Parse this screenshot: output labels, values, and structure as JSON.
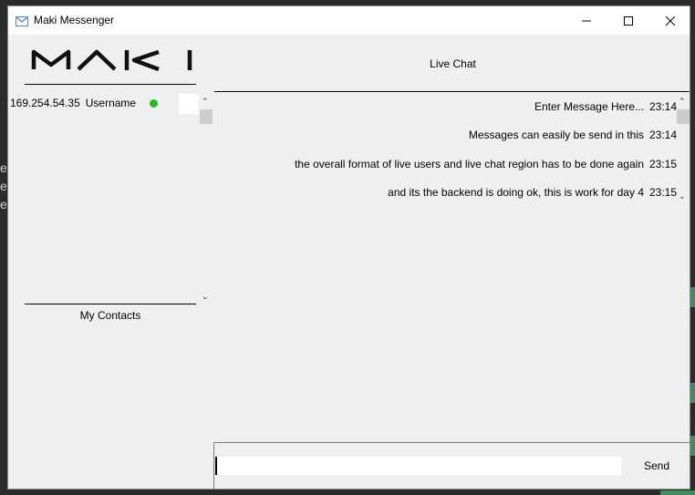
{
  "window": {
    "title": "Maki Messenger",
    "controls": [
      "minimize",
      "maximize",
      "close"
    ]
  },
  "logo": {
    "text": "MAKI"
  },
  "contacts": {
    "items": [
      {
        "ip": "169.254.54.35",
        "username": "Username",
        "status": "online",
        "status_color": "#18c21d"
      }
    ],
    "label": "My Contacts"
  },
  "chat": {
    "label": "Live Chat",
    "messages": [
      {
        "text": "Enter Message Here...",
        "time": "23:14"
      },
      {
        "text": "Messages can easily be send in this",
        "time": "23:14"
      },
      {
        "text": "the overall format of live users and live chat region has to be done again",
        "time": "23:15"
      },
      {
        "text": "and its the backend is doing ok, this is work for day 4",
        "time": "23:15"
      }
    ]
  },
  "composer": {
    "value": "",
    "send_label": "Send"
  },
  "icons": {
    "app": "gmail-envelope-icon",
    "minimize": "minimize-icon",
    "maximize": "maximize-icon",
    "close": "close-icon"
  }
}
